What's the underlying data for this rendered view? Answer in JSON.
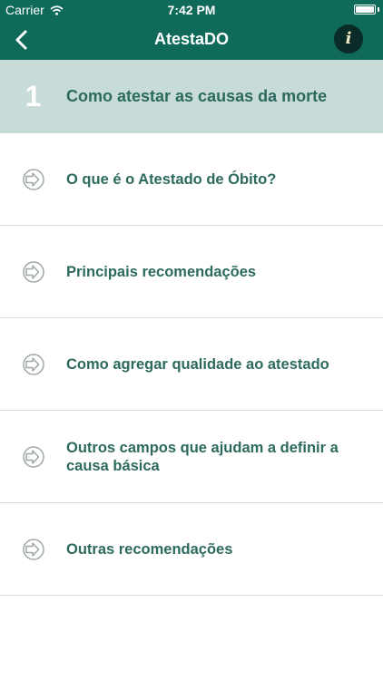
{
  "status_bar": {
    "carrier": "Carrier",
    "time": "7:42 PM"
  },
  "nav": {
    "title": "AtestaDO",
    "back_icon": "chevron-left-icon",
    "info_icon": "info-icon",
    "info_glyph": "i"
  },
  "section": {
    "number": "1",
    "title": "Como atestar as causas da morte"
  },
  "menu": {
    "items": [
      {
        "label": "O que é o Atestado de Óbito?"
      },
      {
        "label": "Principais recomendações"
      },
      {
        "label": "Como agregar qualidade ao atestado"
      },
      {
        "label": "Outros campos que ajudam a definir a causa básica"
      },
      {
        "label": "Outras recomendações"
      }
    ]
  },
  "colors": {
    "header_bg": "#0f6a59",
    "section_bg": "#c7dbd8",
    "text_accent": "#2d6a5e",
    "icon_gray": "#9fa8a6"
  }
}
